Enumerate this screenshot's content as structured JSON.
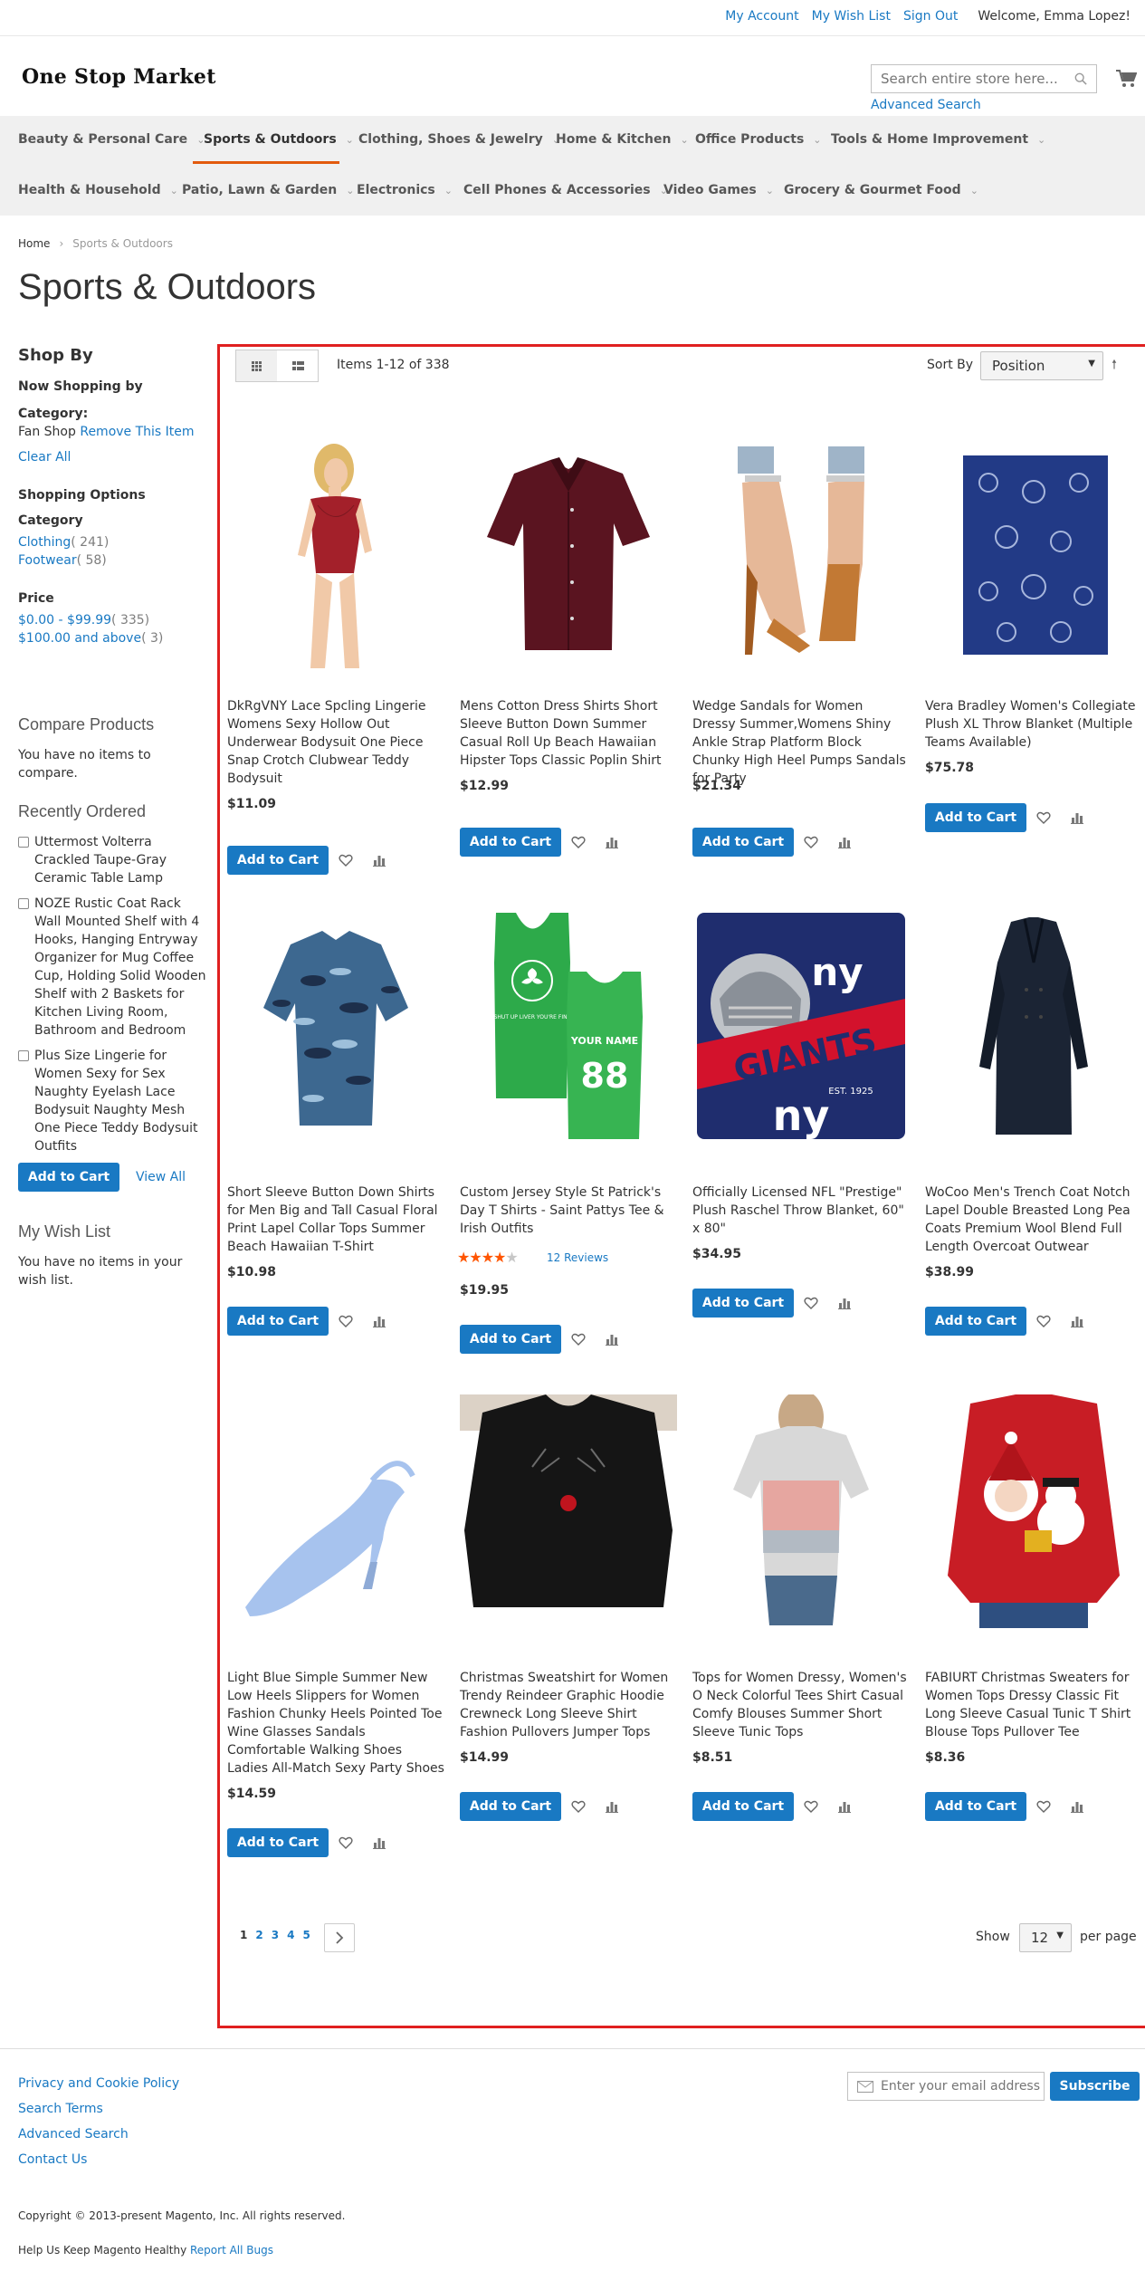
{
  "header": {
    "links": {
      "my_account": "My Account",
      "wish_list": "My Wish List",
      "sign_out": "Sign Out"
    },
    "welcome": "Welcome, Emma Lopez!",
    "logo": "One Stop Market",
    "search_placeholder": "Search entire store here...",
    "advanced_search": "Advanced Search"
  },
  "nav": {
    "row1": [
      "Beauty & Personal Care",
      "Sports & Outdoors",
      "Clothing, Shoes & Jewelry",
      "Home & Kitchen",
      "Office Products",
      "Tools & Home Improvement"
    ],
    "row2": [
      "Health & Household",
      "Patio, Lawn & Garden",
      "Electronics",
      "Cell Phones & Accessories",
      "Video Games",
      "Grocery & Gourmet Food"
    ],
    "active": "Sports & Outdoors",
    "accent_color": "#e25a0d"
  },
  "breadcrumb": {
    "home": "Home",
    "current": "Sports & Outdoors"
  },
  "page_title": "Sports & Outdoors",
  "sidebar": {
    "shop_by": "Shop By",
    "now_shopping_by": "Now Shopping by",
    "category_label": "Category:",
    "category_value": "Fan Shop",
    "remove": "Remove This Item",
    "clear_all": "Clear All",
    "shopping_options": "Shopping Options",
    "category_heading": "Category",
    "categories": [
      {
        "name": "Clothing",
        "count": "( 241)"
      },
      {
        "name": "Footwear",
        "count": "( 58)"
      }
    ],
    "price_heading": "Price",
    "prices": [
      {
        "name": "$0.00 - $99.99",
        "count": "( 335)"
      },
      {
        "name": "$100.00 and above",
        "count": "( 3)"
      }
    ],
    "compare_title": "Compare Products",
    "compare_empty": "You have no items to compare.",
    "recently_ordered_title": "Recently Ordered",
    "recently_ordered": [
      "Uttermost Volterra Crackled Taupe-Gray Ceramic Table Lamp",
      "NOZE Rustic Coat Rack Wall Mounted Shelf with 4 Hooks, Hanging Entryway Organizer for Mug Coffee Cup, Holding Solid Wooden Shelf with 2 Baskets for Kitchen Living Room, Bathroom and Bedroom",
      "Plus Size Lingerie for Women Sexy for Sex Naughty Eyelash Lace Bodysuit Naughty Mesh One Piece Teddy Bodysuit Outfits"
    ],
    "add_to_cart": "Add to Cart",
    "view_all": "View All",
    "wishlist_title": "My Wish List",
    "wishlist_empty": "You have no items in your wish list."
  },
  "toolbar": {
    "items": "Items 1-12 of 338",
    "sort_by": "Sort By",
    "sort_value": "Position",
    "show": "Show",
    "limit": "12",
    "per_page": "per page",
    "pages": [
      "1",
      "2",
      "3",
      "4",
      "5"
    ],
    "current_page": "1"
  },
  "products": [
    {
      "name": "DkRgVNY Lace Spcling Lingerie Womens Sexy Hollow Out Underwear Bodysuit One Piece Snap Crotch Clubwear Teddy Bodysuit",
      "price": "$11.09"
    },
    {
      "name": "Mens Cotton Dress Shirts Short Sleeve Button Down Summer Casual Roll Up Beach Hawaiian Hipster Tops Classic Poplin Shirt",
      "price": "$12.99"
    },
    {
      "name": "Wedge Sandals for Women Dressy Summer,Womens Shiny Ankle Strap Platform Block Chunky High Heel Pumps Sandals for Party",
      "price": "$21.34"
    },
    {
      "name": "Vera Bradley Women's Collegiate Plush XL Throw Blanket (Multiple Teams Available)",
      "price": "$75.78"
    },
    {
      "name": "Short Sleeve Button Down Shirts for Men Big and Tall Casual Floral Print Lapel Collar Tops Summer Beach Hawaiian T-Shirt",
      "price": "$10.98"
    },
    {
      "name": "Custom Jersey Style St Patrick's Day T Shirts - Saint Pattys Tee & Irish Outfits",
      "price": "$19.95",
      "rating": 4,
      "reviews": "12  Reviews",
      "print_front": "SHUT UP LIVER YOU'RE FINE",
      "print_back_name": "YOUR NAME",
      "print_back_number": "88"
    },
    {
      "name": "Officially Licensed NFL \"Prestige\" Plush Raschel Throw Blanket, 60\" x 80\"",
      "price": "$34.95",
      "logo_text": "ny",
      "banner_text": "GIANTS",
      "est_text": "EST. 1925"
    },
    {
      "name": "WoCoo Men's Trench Coat Notch Lapel Double Breasted Long Pea Coats Premium Wool Blend Full Length Overcoat Outwear",
      "price": "$38.99"
    },
    {
      "name": "Light Blue Simple Summer New Low Heels Slippers for Women Fashion Chunky Heels Pointed Toe Wine Glasses Sandals Comfortable Walking Shoes Ladies All-Match Sexy Party Shoes",
      "price": "$14.59"
    },
    {
      "name": "Christmas Sweatshirt for Women Trendy Reindeer Graphic Hoodie Crewneck Long Sleeve Shirt Fashion Pullovers Jumper Tops",
      "price": "$14.99"
    },
    {
      "name": "Tops for Women Dressy, Women's O Neck Colorful Tees Shirt Casual Comfy Blouses Summer Short Sleeve Tunic Tops",
      "price": "$8.51"
    },
    {
      "name": "FABIURT Christmas Sweaters for Women Tops Dressy Classic Fit Long Sleeve Casual Tunic T Shirt Blouse Tops Pullover Tee",
      "price": "$8.36"
    }
  ],
  "product_button": "Add to Cart",
  "footer": {
    "links": [
      "Privacy and Cookie Policy",
      "Search Terms",
      "Advanced Search",
      "Contact Us"
    ],
    "newsletter_placeholder": "Enter your email address",
    "subscribe": "Subscribe",
    "copyright": "Copyright © 2013-present Magento, Inc. All rights reserved.",
    "help_prefix": "Help Us Keep Magento Healthy",
    "report_bugs": "Report All Bugs"
  },
  "colors": {
    "link": "#1979c3",
    "button": "#1979c3",
    "highlight_border": "#e02020",
    "stars": "#ff5501"
  }
}
